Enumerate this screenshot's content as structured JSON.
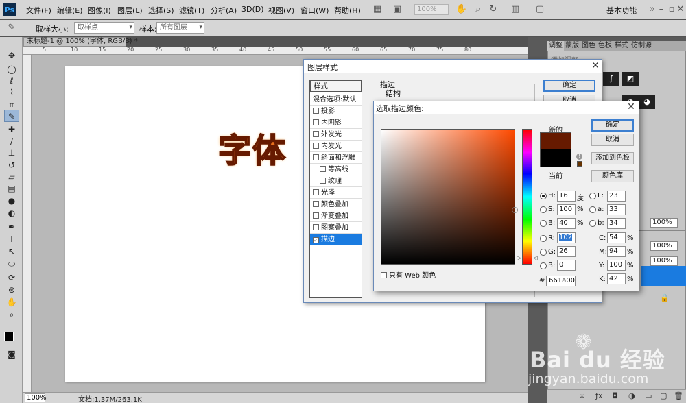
{
  "app": {
    "logo": "Ps",
    "workspace": "基本功能",
    "zoom_display": "100%"
  },
  "menu": [
    "文件(F)",
    "编辑(E)",
    "图像(I)",
    "图层(L)",
    "选择(S)",
    "滤镜(T)",
    "分析(A)",
    "3D(D)",
    "视图(V)",
    "窗口(W)",
    "帮助(H)"
  ],
  "options": {
    "sample_size_label": "取样大小:",
    "sample_size_value": "取样点",
    "sample_label": "样本:",
    "sample_value": "所有图层"
  },
  "document": {
    "tab": "未标题-1 @ 100% (字体, RGB/8) *",
    "canvas_text": "字体",
    "status_zoom": "100%",
    "status_info": "文档:1.37M/263.1K"
  },
  "ruler_ticks": [
    "5",
    "10",
    "15",
    "20",
    "25",
    "30",
    "35",
    "40",
    "45",
    "50",
    "55",
    "60",
    "65",
    "70",
    "75",
    "80"
  ],
  "panels": {
    "tabs": [
      "调整",
      "蒙版",
      "图色",
      "色板",
      "样式",
      "仿制源"
    ],
    "subtitle": "添加调整",
    "percents": [
      "100%",
      "100%",
      "100%"
    ]
  },
  "layer_style": {
    "title": "图层样式",
    "list_header": "样式",
    "items": [
      {
        "label": "混合选项:默认",
        "checkbox": false,
        "checked": false
      },
      {
        "label": "投影",
        "checkbox": true,
        "checked": false
      },
      {
        "label": "内阴影",
        "checkbox": true,
        "checked": false
      },
      {
        "label": "外发光",
        "checkbox": true,
        "checked": false
      },
      {
        "label": "内发光",
        "checkbox": true,
        "checked": false
      },
      {
        "label": "斜面和浮雕",
        "checkbox": true,
        "checked": false
      },
      {
        "label": "等高线",
        "checkbox": true,
        "checked": false
      },
      {
        "label": "纹理",
        "checkbox": true,
        "checked": false
      },
      {
        "label": "光泽",
        "checkbox": true,
        "checked": false
      },
      {
        "label": "颜色叠加",
        "checkbox": true,
        "checked": false
      },
      {
        "label": "渐变叠加",
        "checkbox": true,
        "checked": false
      },
      {
        "label": "图案叠加",
        "checkbox": true,
        "checked": false
      },
      {
        "label": "描边",
        "checkbox": true,
        "checked": true
      }
    ],
    "section": "描边",
    "subsection": "结构",
    "ok": "确定",
    "cancel": "取消"
  },
  "color_picker": {
    "title": "选取描边颜色:",
    "ok": "确定",
    "cancel": "取消",
    "add_swatch": "添加到色板",
    "color_library": "颜色库",
    "new_label": "新的",
    "current_label": "当前",
    "new_color": "#661a00",
    "current_color": "#000000",
    "web_only_label": "只有 Web 颜色",
    "hsb": [
      {
        "label": "H:",
        "value": "16",
        "unit": "度",
        "selected": true
      },
      {
        "label": "S:",
        "value": "100",
        "unit": "%",
        "selected": false
      },
      {
        "label": "B:",
        "value": "40",
        "unit": "%",
        "selected": false
      }
    ],
    "rgb": [
      {
        "label": "R:",
        "value": "102",
        "highlighted": true
      },
      {
        "label": "G:",
        "value": "26",
        "highlighted": false
      },
      {
        "label": "B:",
        "value": "0",
        "highlighted": false
      }
    ],
    "lab": [
      {
        "label": "L:",
        "value": "23"
      },
      {
        "label": "a:",
        "value": "33"
      },
      {
        "label": "b:",
        "value": "34"
      }
    ],
    "cmyk": [
      {
        "label": "C:",
        "value": "54",
        "unit": "%"
      },
      {
        "label": "M:",
        "value": "94",
        "unit": "%"
      },
      {
        "label": "Y:",
        "value": "100",
        "unit": "%"
      },
      {
        "label": "K:",
        "value": "42",
        "unit": "%"
      }
    ],
    "hex_label": "#",
    "hex": "661a00"
  },
  "watermark": {
    "brand": "Bai du 经验",
    "url": "jingyan.baidu.com"
  }
}
